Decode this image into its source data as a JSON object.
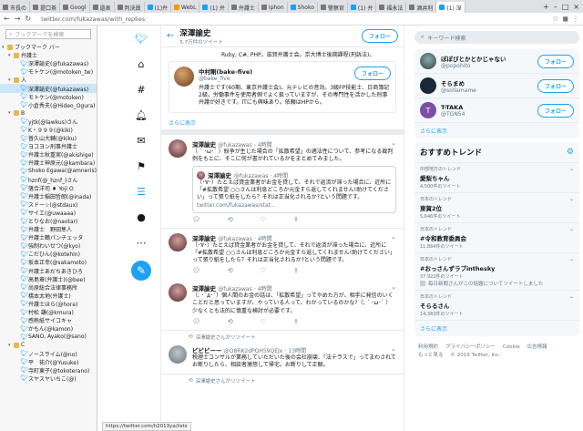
{
  "browser": {
    "tabs": [
      {
        "label": "市長の",
        "fav": "gray"
      },
      {
        "label": "提口茶",
        "fav": "gray"
      },
      {
        "label": "Googl",
        "fav": "gray"
      },
      {
        "label": "遺表",
        "fav": "gray"
      },
      {
        "label": "判決員",
        "fav": "gray"
      },
      {
        "label": "(1)弁",
        "fav": "blue"
      },
      {
        "label": "WebL",
        "fav": "orange"
      },
      {
        "label": "(1) 弁",
        "fav": "blue"
      },
      {
        "label": "弁護士",
        "fav": "gray"
      },
      {
        "label": "iphon",
        "fav": "gray"
      },
      {
        "label": "Shoko",
        "fav": "blue"
      },
      {
        "label": "警察官",
        "fav": "gray"
      },
      {
        "label": "(1) 弁",
        "fav": "blue"
      },
      {
        "label": "福永法",
        "fav": "gray"
      },
      {
        "label": "酒井利",
        "fav": "gray"
      },
      {
        "label": "(1) 深",
        "fav": "blue",
        "active": true
      }
    ],
    "url": "twitter.com/fukazawas/with_replies",
    "status_url": "https://twitter.com/h2013ya/lists"
  },
  "bookmarks": {
    "search_placeholder": "ブックマークを検索",
    "rows": [
      {
        "label": "ブックマーク バー",
        "type": "folder",
        "indent": 0
      },
      {
        "label": "弁護士",
        "type": "folder",
        "indent": 1
      },
      {
        "label": "深澤諭史(@fukazawas)",
        "type": "bird",
        "indent": 2
      },
      {
        "label": "モトケン(@motoken_tw)",
        "type": "bird",
        "indent": 2
      },
      {
        "label": "人",
        "type": "folder",
        "indent": 1
      },
      {
        "label": "深澤諭史(@fukazawas)",
        "type": "bird",
        "indent": 2,
        "selected": true
      },
      {
        "label": "モトケン(@motoken)",
        "type": "bird",
        "indent": 2
      },
      {
        "label": "小倉秀夫(@Hideo_Ogura)",
        "type": "bird",
        "indent": 2
      },
      {
        "label": "B",
        "type": "folder",
        "indent": 1
      },
      {
        "label": "yjtk(@lawkus)さん",
        "type": "bird",
        "indent": 2
      },
      {
        "label": "K・９９９(@kiki)",
        "type": "bird",
        "indent": 2
      },
      {
        "label": "普久山大輔(@kiku)",
        "type": "bird",
        "indent": 2
      },
      {
        "label": "ヨコヨン刑事弁護士",
        "type": "bird",
        "indent": 2
      },
      {
        "label": "弁護士秋重実(@akishige)",
        "type": "bird",
        "indent": 2
      },
      {
        "label": "弁護士神原元(@kambara)",
        "type": "bird",
        "indent": 2
      },
      {
        "label": "Shoko Egawa(@amneris)",
        "type": "bird",
        "indent": 2
      },
      {
        "label": "hznf(@_hznf_)さん",
        "type": "bird",
        "indent": 2
      },
      {
        "label": "落合洋司 ♦ Yoji O",
        "type": "bird",
        "indent": 2
      },
      {
        "label": "弁護士稲田哲朗(@inada)",
        "type": "bird",
        "indent": 2
      },
      {
        "label": "スドー☆(@stdaux)",
        "type": "bird",
        "indent": 2
      },
      {
        "label": "サイエ(@uwaaaa)",
        "type": "bird",
        "indent": 2
      },
      {
        "label": "とりなお(@naotar)",
        "type": "bird",
        "indent": 2
      },
      {
        "label": "弁護士　野田隼人",
        "type": "bird",
        "indent": 2
      },
      {
        "label": "弁護士鶴パンチェッタ",
        "type": "bird",
        "indent": 2
      },
      {
        "label": "強制わいせつ(@kyo)",
        "type": "bird",
        "indent": 2
      },
      {
        "label": "こだひん(@kotehin)",
        "type": "bird",
        "indent": 2
      },
      {
        "label": "坂本正幸(@sakamoto)",
        "type": "bird",
        "indent": 2
      },
      {
        "label": "弁護士あだちあきひろ",
        "type": "bird",
        "indent": 2
      },
      {
        "label": "高島章(弁護士)(@bee)",
        "type": "bird",
        "indent": 2
      },
      {
        "label": "尚原総合法律事務所",
        "type": "bird",
        "indent": 2
      },
      {
        "label": "橋本太地(弁護士)",
        "type": "bird",
        "indent": 2
      },
      {
        "label": "弁護士ほら(@hora)",
        "type": "bird",
        "indent": 2
      },
      {
        "label": "村松 謙(@kmura)",
        "type": "bird",
        "indent": 2
      },
      {
        "label": "感熱紙サイコキャ",
        "type": "bird",
        "indent": 2
      },
      {
        "label": "かもん(@kamon)",
        "type": "bird",
        "indent": 2
      },
      {
        "label": "SANO, Ayako(@sano)",
        "type": "bird",
        "indent": 2
      },
      {
        "label": "C",
        "type": "folder",
        "indent": 1
      },
      {
        "label": "ノースライム(@no)",
        "type": "bird",
        "indent": 2
      },
      {
        "label": "平　祐介(@Yusuke)",
        "type": "bird",
        "indent": 2
      },
      {
        "label": "寺町東子(@tokoterano)",
        "type": "bird",
        "indent": 2
      },
      {
        "label": "スヤスヤいちこ(@)",
        "type": "bird",
        "indent": 2
      }
    ]
  },
  "profile": {
    "name": "深澤諭史",
    "tweet_count": "5.7万件のツイート",
    "follow_label": "フォロー",
    "bio_tail": "Ruby, C#, PHP。滋賀弁護士会。京大博士後期課程(刑訴法)。"
  },
  "profile_card": {
    "name": "中村剛(bake-five)",
    "handle": "@bake_five",
    "follow_label": "フォロー",
    "text": "弁護士です(60期、東京弁護士会)。元テレビの音効。3級FP技能士、日商簿記2級。労働事件を使用者側でよく扱っていますが、その専門性を活かした刑事弁護が好きです。ITにも興味あり。依頼はHPから。",
    "show_more": "さらに表示"
  },
  "tweets": [
    {
      "name": "深澤諭史",
      "handle": "@fukazawas",
      "time": "· 4時間",
      "text": "（ ´ ･ω･` ）紛争が生じた場合の「拡散希望」の適法性について、参考になる裁判例をもとに、そこに何が書かれているかをまとめてみました。",
      "quote": {
        "name": "深澤諭史",
        "handle": "@fukazawas · 4時間",
        "text": "（･∀･）たとえば貸金業者がお金を貸して、それで返済が滞った場合に、近所に「#拡散希望 ○○さんは利息どころか元金すら返してくれません!助けてください」って張り紙をしたら？それは正当化されるか?という問題です。",
        "link": "twitter.com/fukazawas/stat..."
      }
    },
    {
      "name": "深澤諭史",
      "handle": "@fukazawas",
      "time": "· 4時間",
      "text": "（･∀･）たとえば貸金業者がお金を貸して、それで返済が滞った場合に、近所に「#拡散希望 ○○さんは利息どころか元金すら返してくれません!助けてください」って張り紙をしたら？それは正当化されるか?という問題です。"
    },
    {
      "name": "深澤諭史",
      "handle": "@fukazawas",
      "time": "· 4時間",
      "text": "（; ･`д･´）個人間のお金の話は、「拡散希望」ってやめた方が、相手に発信のいくことだと思っていますが、やっている人って、わかっているのかな?（; ´ ･ω･` ）少なくとも法的に慎重な検討が必要です。"
    }
  ],
  "retweet_note": "深澤諭史さんがリツイート",
  "retweet_tweet": {
    "name": "ビビビーー",
    "handle": "@O8RK2dPQH59QEJx",
    "time": "· 13時間",
    "text": "税理士コンサルが業務していただいた後の会社崩壊、「法テラスで」ってまわされてお断りしたら、相談者激怒して帰宅。お断りして正解。"
  },
  "retweet_note2": "深澤諭史さんがリツイート",
  "right": {
    "search_placeholder": "キーワード検索",
    "suggestions": [
      {
        "name": "ぽぽぴとかとかじゃない",
        "handle": "@popohito",
        "follow": "フォロー"
      },
      {
        "name": "そらまめ",
        "handle": "@sollamame",
        "follow": "フォロー"
      },
      {
        "name": "T-TAKA",
        "handle": "@TGN54",
        "follow": "フォロー"
      }
    ],
    "show_more": "さらに表示",
    "trends_title": "おすすめトレンド",
    "trends": [
      {
        "loc": "中部地方のトレンド",
        "name": "愛梨ちゃん",
        "count": "4,500件のツイート"
      },
      {
        "loc": "日本のトレンド",
        "name": "東賀2位",
        "count": "5,646件のツイート"
      },
      {
        "loc": "日本のトレンド",
        "name": "#令和教育委員会",
        "count": "11,884件のツイート"
      },
      {
        "loc": "日本のトレンド",
        "name": "#おっさんずラブinthesky",
        "count": "37,922件のツイート",
        "news": "毎日新聞さんがこの話題についてツイートしました"
      },
      {
        "loc": "日本のトレンド",
        "name": "そらるさん",
        "count": "14,383件のツイート"
      }
    ],
    "trends_more": "さらに表示",
    "footer": [
      "利用規約",
      "プライバシーポリシー",
      "Cookie",
      "広告情報",
      "もっと見る",
      "© 2019 Twitter, Inc."
    ]
  }
}
